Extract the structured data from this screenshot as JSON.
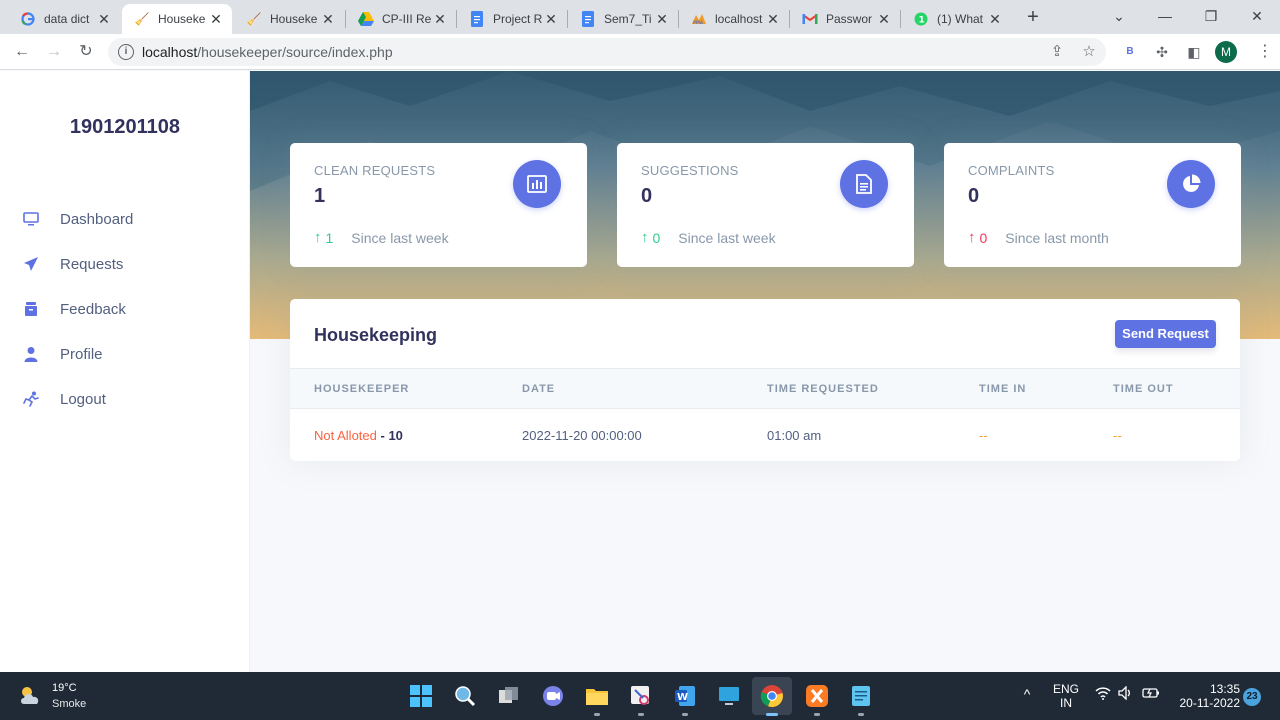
{
  "browser": {
    "tabs": [
      {
        "title": "data dict",
        "icon": "google-icon"
      },
      {
        "title": "Houseke",
        "icon": "broom-icon"
      },
      {
        "title": "Houseke",
        "icon": "broom-icon"
      },
      {
        "title": "CP-III Re",
        "icon": "drive-icon"
      },
      {
        "title": "Project R",
        "icon": "docs-icon"
      },
      {
        "title": "Sem7_Ti",
        "icon": "docs-icon"
      },
      {
        "title": "localhost",
        "icon": "phpmyadmin-icon"
      },
      {
        "title": "Passwor",
        "icon": "gmail-icon"
      },
      {
        "title": "(1) What",
        "icon": "whatsapp-icon"
      }
    ],
    "url_host": "localhost",
    "url_path": "/housekeeper/source/index.php",
    "profile_initial": "M",
    "extension_letter": "B"
  },
  "sidebar": {
    "brand": "1901201108",
    "items": [
      {
        "label": "Dashboard",
        "icon": "monitor-icon"
      },
      {
        "label": "Requests",
        "icon": "paper-plane-icon"
      },
      {
        "label": "Feedback",
        "icon": "archive-icon"
      },
      {
        "label": "Profile",
        "icon": "user-icon"
      },
      {
        "label": "Logout",
        "icon": "running-icon"
      }
    ]
  },
  "stats": [
    {
      "label": "CLEAN REQUESTS",
      "value": "1",
      "change": "1",
      "period": "Since last week",
      "trend": "up",
      "trend_color": "#2dce89",
      "icon": "bar-chart-icon"
    },
    {
      "label": "SUGGESTIONS",
      "value": "0",
      "change": "0",
      "period": "Since last week",
      "trend": "up",
      "trend_color": "#2dce89",
      "icon": "document-icon"
    },
    {
      "label": "COMPLAINTS",
      "value": "0",
      "change": "0",
      "period": "Since last month",
      "trend": "up",
      "trend_color": "#f5365c",
      "icon": "pie-chart-icon"
    }
  ],
  "housekeeping": {
    "title": "Housekeeping",
    "button": "Send Request",
    "columns": [
      "HOUSEKEEPER",
      "DATE",
      "TIME REQUESTED",
      "TIME IN",
      "TIME OUT"
    ],
    "rows": [
      {
        "status": "Not Alloted",
        "room": "- 10",
        "date": "2022-11-20 00:00:00",
        "time_requested": "01:00 am",
        "time_in": "--",
        "time_out": "--"
      }
    ]
  },
  "taskbar": {
    "temperature": "19°C",
    "weather": "Smoke",
    "language": "ENG",
    "region": "IN",
    "time": "13:35",
    "date": "20-11-2022",
    "notifications": "23"
  },
  "colors": {
    "accent": "#5e72e4",
    "orange": "#fb6340"
  }
}
